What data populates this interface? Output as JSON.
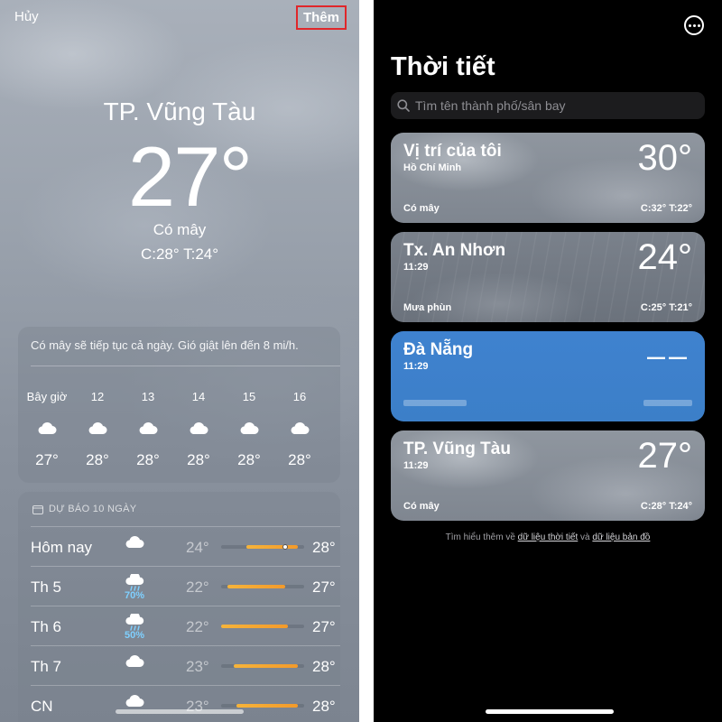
{
  "left": {
    "cancel_label": "Hủy",
    "add_label": "Thêm",
    "city": "TP. Vũng Tàu",
    "temperature": "27°",
    "condition": "Có mây",
    "high_low": "C:28°  T:24°",
    "hourly": {
      "summary": "Có mây sẽ tiếp tục cả ngày. Gió giật lên đến 8 mi/h.",
      "items": [
        {
          "label": "Bây giờ",
          "icon": "cloud-icon",
          "temp": "27°"
        },
        {
          "label": "12",
          "icon": "cloud-icon",
          "temp": "28°"
        },
        {
          "label": "13",
          "icon": "cloud-icon",
          "temp": "28°"
        },
        {
          "label": "14",
          "icon": "cloud-icon",
          "temp": "28°"
        },
        {
          "label": "15",
          "icon": "cloud-icon",
          "temp": "28°"
        },
        {
          "label": "16",
          "icon": "cloud-icon",
          "temp": "28°"
        }
      ]
    },
    "daily": {
      "header": "DỰ BÁO 10 NGÀY",
      "range_min": 22,
      "range_max": 28,
      "rows": [
        {
          "day": "Hôm nay",
          "icon": "cloud-icon",
          "precip": "",
          "low": "24°",
          "high": "28°",
          "low_val": 24,
          "high_val": 28,
          "current_val": 27
        },
        {
          "day": "Th 5",
          "icon": "cloud-rain-icon",
          "precip": "70%",
          "low": "22°",
          "high": "27°",
          "low_val": 22.5,
          "high_val": 27
        },
        {
          "day": "Th 6",
          "icon": "cloud-rain-icon",
          "precip": "50%",
          "low": "22°",
          "high": "27°",
          "low_val": 22,
          "high_val": 27.2
        },
        {
          "day": "Th 7",
          "icon": "cloud-icon",
          "precip": "",
          "low": "23°",
          "high": "28°",
          "low_val": 23,
          "high_val": 28
        },
        {
          "day": "CN",
          "icon": "cloud-icon",
          "precip": "",
          "low": "23°",
          "high": "28°",
          "low_val": 23.2,
          "high_val": 28
        }
      ]
    }
  },
  "right": {
    "title": "Thời tiết",
    "search_placeholder": "Tìm tên thành phố/sân bay",
    "cards": [
      {
        "name": "Vị trí của tôi",
        "sub": "Hồ Chí Minh",
        "temp": "30°",
        "desc": "Có mây",
        "hl": "C:32°  T:22°"
      },
      {
        "name": "Tx. An Nhơn",
        "sub": "11:29",
        "temp": "24°",
        "desc": "Mưa phùn",
        "hl": "C:25°  T:21°"
      },
      {
        "name": "Đà Nẵng",
        "sub": "11:29",
        "temp": "––"
      },
      {
        "name": "TP. Vũng Tàu",
        "sub": "11:29",
        "temp": "27°",
        "desc": "Có mây",
        "hl": "C:28°  T:24°"
      }
    ],
    "footer_prefix": "Tìm hiểu thêm về ",
    "footer_link1": "dữ liệu thời tiết",
    "footer_mid": " và ",
    "footer_link2": "dữ liệu bản đồ"
  },
  "colors": {
    "accent_red": "#e0262a",
    "bar_orange": "#f6b43a",
    "precip_blue": "#7fd0ff",
    "card_blue": "#3f82cf"
  }
}
